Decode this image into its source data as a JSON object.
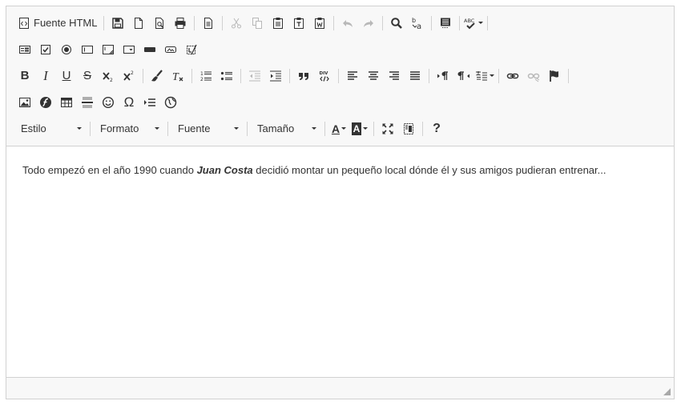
{
  "toolbar": {
    "source_label": "Fuente HTML",
    "styles": {
      "label": "Estilo"
    },
    "format": {
      "label": "Formato"
    },
    "font": {
      "label": "Fuente"
    },
    "size": {
      "label": "Tamaño"
    },
    "bold": "B",
    "italic": "I",
    "underline": "U",
    "strike": "S",
    "omega": "Ω",
    "help": "?",
    "font_color": "A",
    "bg_color": "A"
  },
  "content": {
    "text_before": "Todo empezó en el año 1990 cuando ",
    "bold_name": "Juan Costa",
    "text_after": " decidió montar un pequeño local dónde él y sus amigos pudieran entrenar..."
  },
  "colors": {
    "toolbar_bg": "#f8f8f8",
    "border": "#d1d1d1",
    "icon": "#333333",
    "disabled_icon": "#b8b8b8"
  }
}
